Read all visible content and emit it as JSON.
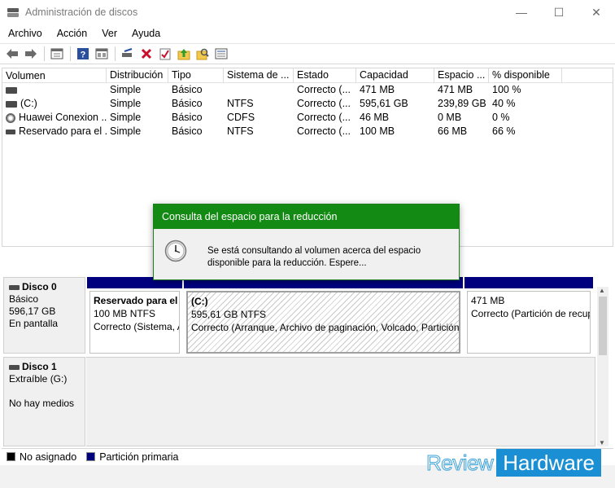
{
  "window": {
    "title": "Administración de discos",
    "minimize": "—",
    "maximize": "☐",
    "close": "✕"
  },
  "menu": [
    "Archivo",
    "Acción",
    "Ver",
    "Ayuda"
  ],
  "toolbar_icons": [
    "back-arrow-icon",
    "forward-arrow-icon",
    "properties-icon",
    "help-icon",
    "view-icon",
    "connect-icon",
    "delete-icon",
    "check-icon",
    "up-folder-icon",
    "search-folder-icon",
    "list-view-icon"
  ],
  "volume_table": {
    "headers": [
      "Volumen",
      "Distribución",
      "Tipo",
      "Sistema de ...",
      "Estado",
      "Capacidad",
      "Espacio ...",
      "% disponible"
    ],
    "rows": [
      {
        "icon": "disk-icon",
        "cells": [
          "",
          "Simple",
          "Básico",
          "",
          "Correcto (...",
          "471 MB",
          "471 MB",
          "100 %"
        ]
      },
      {
        "icon": "disk-icon",
        "cells": [
          "(C:)",
          "Simple",
          "Básico",
          "NTFS",
          "Correcto (...",
          "595,61 GB",
          "239,89 GB",
          "40 %"
        ]
      },
      {
        "icon": "cd-icon",
        "cells": [
          "Huawei Conexion ...",
          "Simple",
          "Básico",
          "CDFS",
          "Correcto (...",
          "46 MB",
          "0 MB",
          "0 %"
        ]
      },
      {
        "icon": "disk-icon",
        "cells": [
          "Reservado para el ...",
          "Simple",
          "Básico",
          "NTFS",
          "Correcto (...",
          "100 MB",
          "66 MB",
          "66 %"
        ]
      }
    ]
  },
  "dialog": {
    "title": "Consulta del espacio para la reducción",
    "line1": "Se está consultando al volumen acerca del espacio",
    "line2": "disponible para la reducción. Espere..."
  },
  "disks": {
    "disk0": {
      "name": "Disco 0",
      "type": "Básico",
      "size": "596,17 GB",
      "status": "En pantalla",
      "partitions": [
        {
          "title": "Reservado para el s",
          "size": "100 MB NTFS",
          "status": "Correcto (Sistema, A"
        },
        {
          "title": "(C:)",
          "size": "595,61 GB NTFS",
          "status": "Correcto (Arranque, Archivo de paginación, Volcado, Partición"
        },
        {
          "title": "",
          "size": "471 MB",
          "status": "Correcto (Partición de recup"
        }
      ]
    },
    "disk1": {
      "name": "Disco 1",
      "type": "Extraíble (G:)",
      "status": "No hay medios"
    }
  },
  "legend": [
    {
      "label": "No asignado",
      "color": "#000000"
    },
    {
      "label": "Partición primaria",
      "color": "#00007f"
    }
  ],
  "watermark": {
    "part1": "Review",
    "part2": "Hardware"
  }
}
